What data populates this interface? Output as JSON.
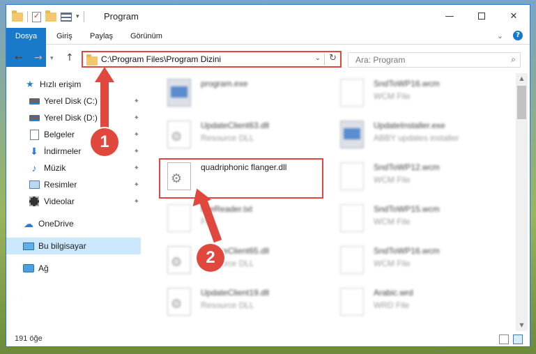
{
  "window": {
    "title": "Program",
    "controls": {
      "minimize": "—",
      "close": "✕"
    }
  },
  "ribbon": {
    "tabs": [
      {
        "label": "Dosya"
      },
      {
        "label": "Giriş"
      },
      {
        "label": "Paylaş"
      },
      {
        "label": "Görünüm"
      }
    ],
    "help": "?"
  },
  "nav": {
    "back": "←",
    "forward": "→",
    "up": "↑",
    "address": "C:\\Program Files\\Program Dizini",
    "search_placeholder": "Ara: Program"
  },
  "sidebar": {
    "items": [
      {
        "label": "Hızlı erişim",
        "icon": "star-icon"
      },
      {
        "label": "Yerel Disk (C:)",
        "icon": "drive-icon"
      },
      {
        "label": "Yerel Disk (D:)",
        "icon": "drive-icon"
      },
      {
        "label": "Belgeler",
        "icon": "documents-icon"
      },
      {
        "label": "İndirmeler",
        "icon": "download-icon"
      },
      {
        "label": "Müzik",
        "icon": "music-icon"
      },
      {
        "label": "Resimler",
        "icon": "pictures-icon"
      },
      {
        "label": "Videolar",
        "icon": "video-icon"
      },
      {
        "label": "OneDrive",
        "icon": "cloud-icon"
      },
      {
        "label": "Bu bilgisayar",
        "icon": "computer-icon"
      },
      {
        "label": "Ağ",
        "icon": "network-icon"
      }
    ]
  },
  "files": {
    "left": [
      {
        "name": "program.exe",
        "type": ""
      },
      {
        "name": "UpdateClient63.dll",
        "type": "Resource DLL"
      },
      {
        "name": "quadriphonic flanger.dll",
        "type": ""
      },
      {
        "name": "fineReader.txt",
        "type": "File"
      },
      {
        "name": "UpdateClient65.dll",
        "type": "Resource DLL"
      },
      {
        "name": "UpdateClient19.dll",
        "type": "Resource DLL"
      }
    ],
    "right": [
      {
        "name": "SndToWP16.wcm",
        "type": "WCM File"
      },
      {
        "name": "UpdateInstaller.exe",
        "type": "ABBY updates installer"
      },
      {
        "name": "SndToWP12.wcm",
        "type": "WCM File"
      },
      {
        "name": "SndToWP15.wcm",
        "type": "WCM File"
      },
      {
        "name": "SndToWP16.wcm",
        "type": "WCM File"
      },
      {
        "name": "Arabic.wrd",
        "type": "WRD File"
      }
    ]
  },
  "status": {
    "count": "191 öğe"
  },
  "annotations": {
    "step1": "1",
    "step2": "2"
  },
  "colors": {
    "accent": "#1979ca",
    "annotation": "#e0483e",
    "selected": "#cce8ff"
  }
}
